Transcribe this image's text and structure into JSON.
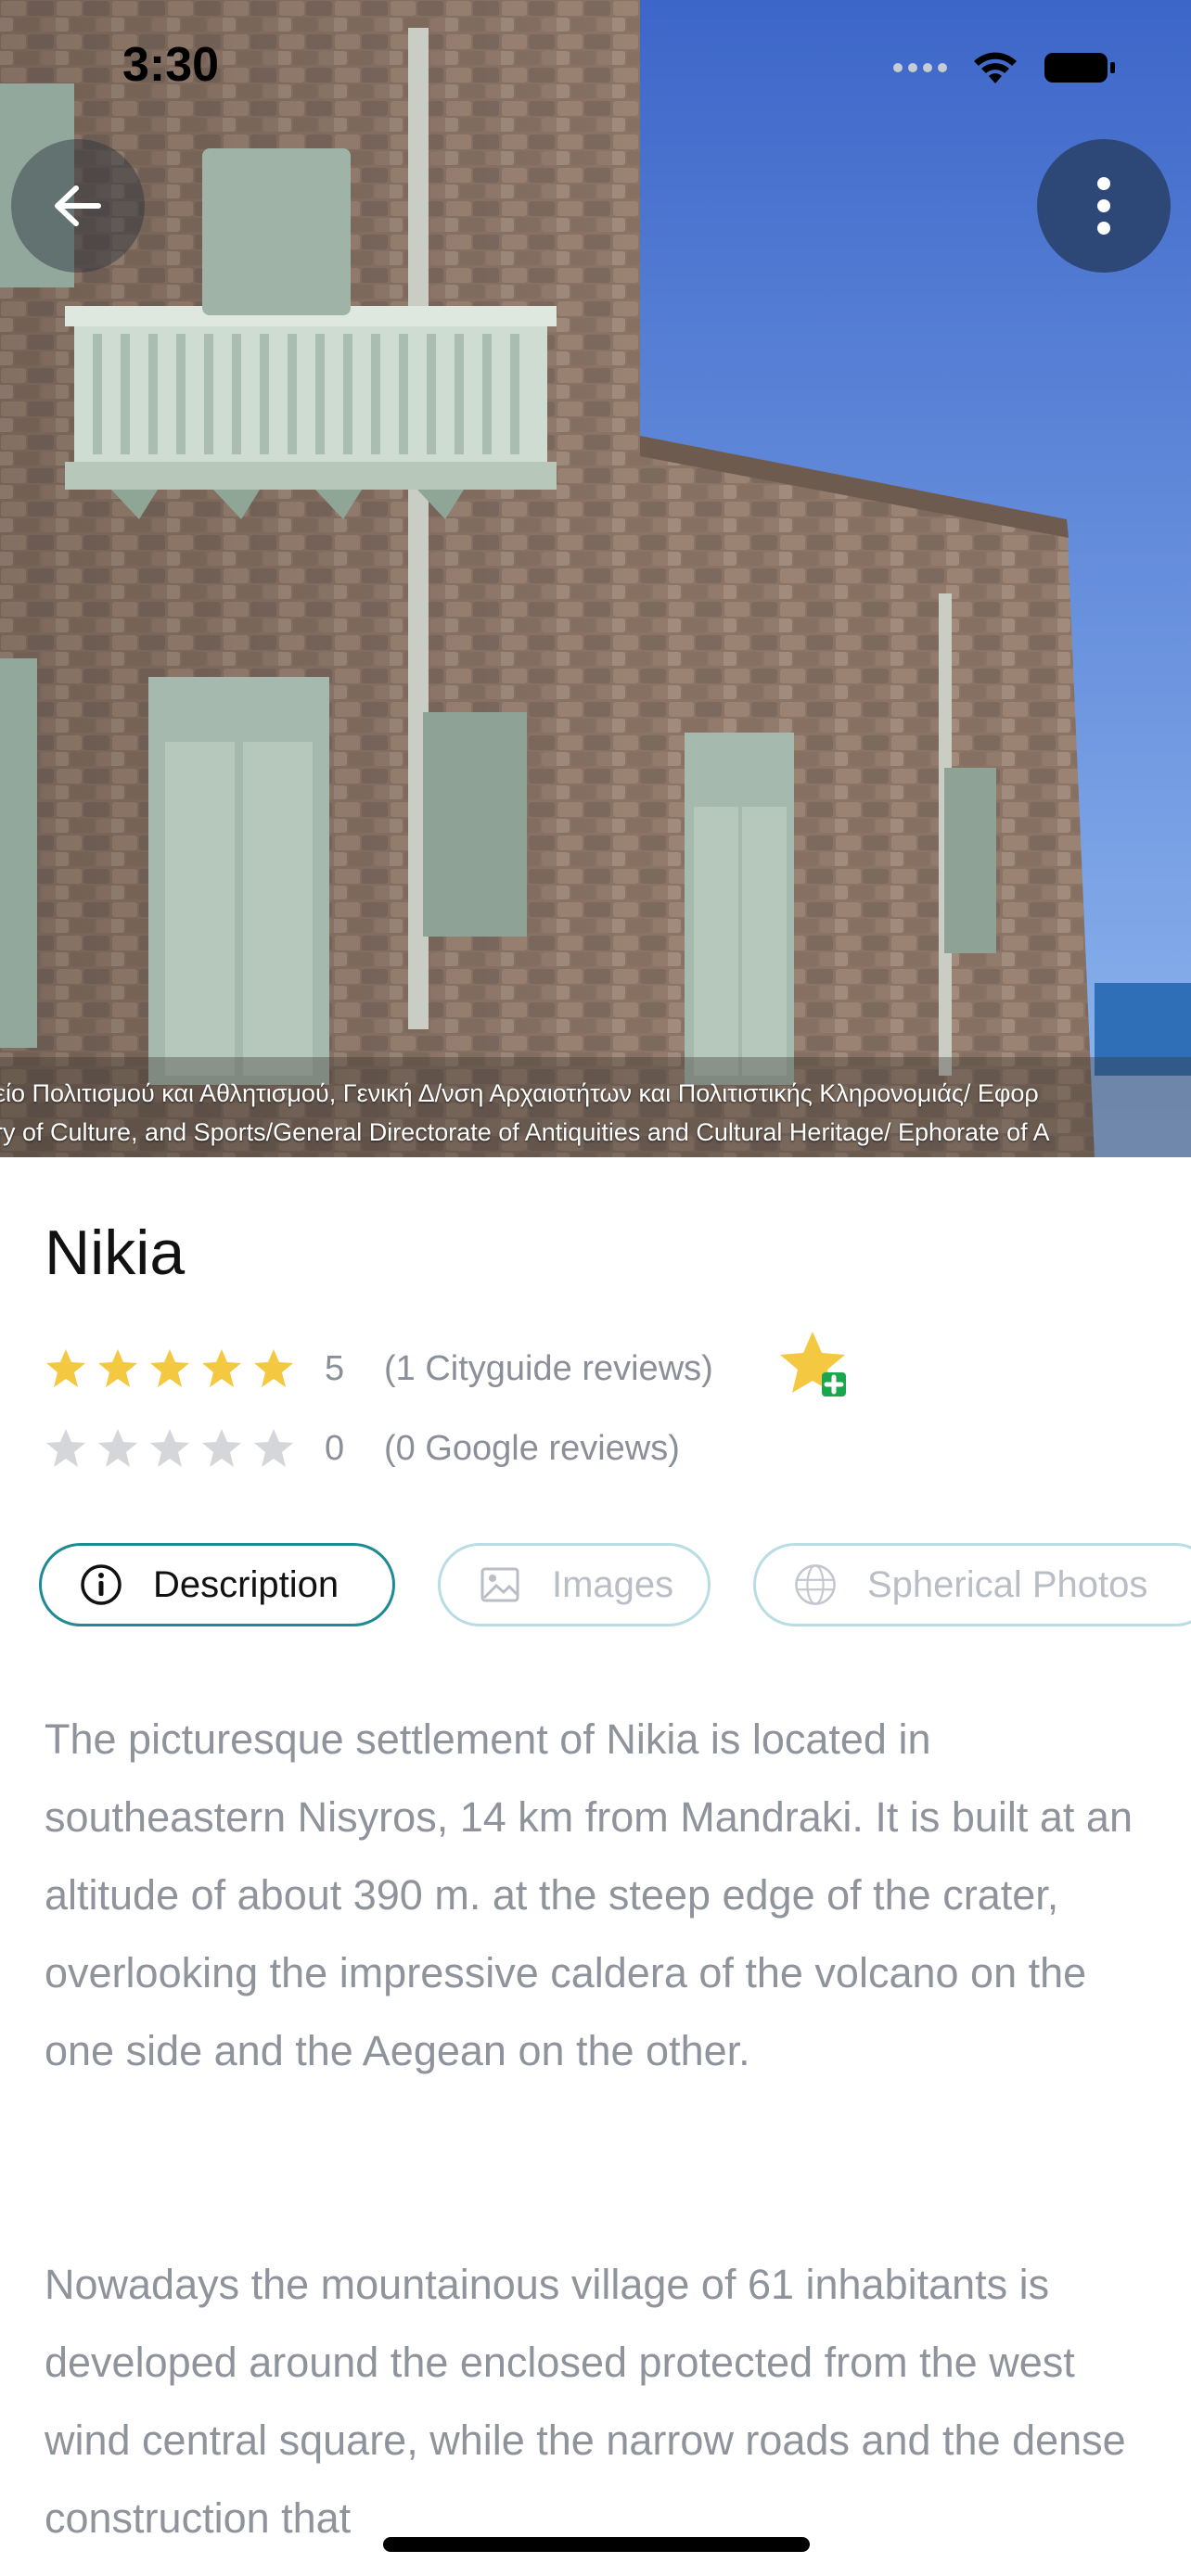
{
  "status_bar": {
    "time": "3:30"
  },
  "hero": {
    "credit_lines": [
      "είο Πολιτισμού και Αθλητισμού, Γενική Δ/νση Αρχαιοτήτων και Πολιτιστικής Κληρονομιάς/ Εφορ",
      "ry of Culture, and Sports/General Directorate of Antiquities and Cultural Heritage/ Ephorate of A"
    ]
  },
  "place": {
    "title": "Nikia"
  },
  "ratings": {
    "cityguide": {
      "score": "5",
      "label": "(1 Cityguide reviews)",
      "stars": 5
    },
    "google": {
      "score": "0",
      "label": "(0 Google reviews)",
      "stars": 0
    }
  },
  "tabs": [
    {
      "label": "Description",
      "icon": "info-icon",
      "active": true
    },
    {
      "label": "Images",
      "icon": "image-icon",
      "active": false
    },
    {
      "label": "Spherical Photos",
      "icon": "globe-360-icon",
      "active": false
    }
  ],
  "description": {
    "paragraphs": [
      "The picturesque settlement of Nikia is located in southeastern Nisyros, 14 km from Mandraki. It is built at an altitude of about 390 m. at the steep edge of the crater, overlooking the impressive caldera of the volcano on the one side and the Aegean on the other.",
      "Nowadays the mountainous village of 61 inhabitants is developed around the enclosed protected from the west wind central square, while the narrow roads and the dense construction that"
    ]
  },
  "colors": {
    "accent": "#1e8a93",
    "menu_button": "#2d4876",
    "star_filled": "#f5c842",
    "star_empty": "#d4d6da",
    "body_text": "#8f949c"
  }
}
